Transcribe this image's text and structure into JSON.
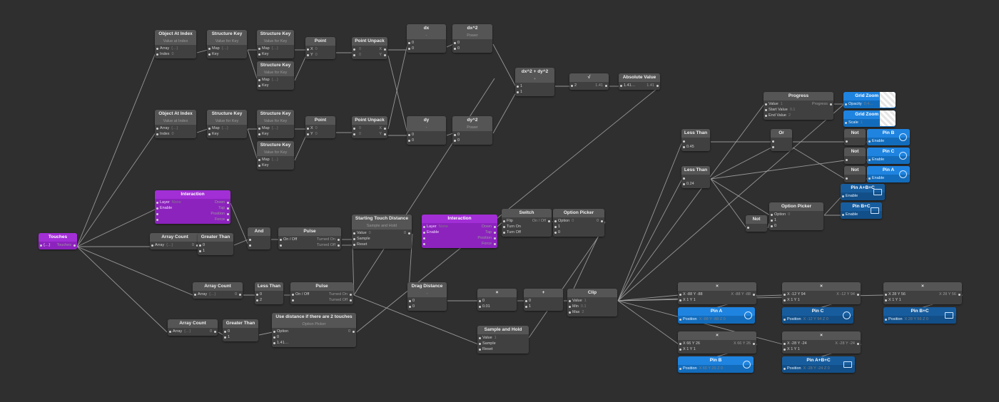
{
  "nodes": {
    "obj_at_index_1": {
      "title": "Object At Index",
      "sub": "Value at Index",
      "rows": [
        {
          "label": "Array",
          "value": "{…}"
        },
        {
          "label": "Index",
          "value": "0"
        }
      ]
    },
    "struct_key_1": {
      "title": "Structure Key",
      "sub": "Value for Key",
      "rows": [
        {
          "label": "Map",
          "value": "{…}"
        },
        {
          "label": "Key",
          "value": ""
        }
      ]
    },
    "struct_key_2": {
      "title": "Structure Key",
      "sub": "Value for Key",
      "rows": [
        {
          "label": "Map",
          "value": "{…}"
        },
        {
          "label": "Key",
          "value": ""
        }
      ]
    },
    "struct_key_3": {
      "title": "Structure Key",
      "sub": "Value for Key",
      "rows": [
        {
          "label": "Map",
          "value": "{…}"
        },
        {
          "label": "Key",
          "value": ""
        }
      ]
    },
    "point_1": {
      "title": "Point",
      "rows": [
        {
          "label": "X",
          "value": "0"
        },
        {
          "label": "Y",
          "value": "0"
        }
      ]
    },
    "point_unpack_1": {
      "title": "Point Unpack",
      "rows": [
        {
          "label": "",
          "value": "0",
          "out": "X"
        },
        {
          "label": "",
          "value": "0",
          "out": "Y"
        }
      ]
    },
    "dx": {
      "title": "dx",
      "sub": "-",
      "rows": [
        {
          "label": "0"
        },
        {
          "label": "0"
        }
      ]
    },
    "dx2": {
      "title": "dx^2",
      "sub": "Power",
      "rows": [
        {
          "label": "0"
        },
        {
          "label": "0"
        }
      ]
    },
    "obj_at_index_2": {
      "title": "Object At Index",
      "sub": "Value at Index",
      "rows": [
        {
          "label": "Array",
          "value": "{…}"
        },
        {
          "label": "Index",
          "value": "0"
        }
      ]
    },
    "struct_key_4": {
      "title": "Structure Key",
      "sub": "Value for Key",
      "rows": [
        {
          "label": "Map",
          "value": "{…}"
        },
        {
          "label": "Key",
          "value": ""
        }
      ]
    },
    "struct_key_5": {
      "title": "Structure Key",
      "sub": "Value for Key",
      "rows": [
        {
          "label": "Map",
          "value": "{…}"
        },
        {
          "label": "Key",
          "value": ""
        }
      ]
    },
    "struct_key_6": {
      "title": "Structure Key",
      "sub": "Value for Key",
      "rows": [
        {
          "label": "Map",
          "value": "{…}"
        },
        {
          "label": "Key",
          "value": ""
        }
      ]
    },
    "point_2": {
      "title": "Point",
      "rows": [
        {
          "label": "X",
          "value": "0"
        },
        {
          "label": "Y",
          "value": "0"
        }
      ]
    },
    "point_unpack_2": {
      "title": "Point Unpack",
      "rows": [
        {
          "label": "",
          "value": "0",
          "out": "X"
        },
        {
          "label": "",
          "value": "0",
          "out": "Y"
        }
      ]
    },
    "dy": {
      "title": "dy",
      "sub": "-",
      "rows": [
        {
          "label": "0"
        },
        {
          "label": "0"
        }
      ]
    },
    "dy2": {
      "title": "dy^2",
      "sub": "Power",
      "rows": [
        {
          "label": "0"
        },
        {
          "label": "0"
        }
      ]
    },
    "sum": {
      "title": "dx^2 + dy^2",
      "sub": "+",
      "rows": [
        {
          "label": "1"
        },
        {
          "label": "1"
        }
      ]
    },
    "sqrt": {
      "title": "√",
      "rows": [
        {
          "label": "2",
          "out": "1.41"
        }
      ]
    },
    "absval": {
      "title": "Absolute Value",
      "rows": [
        {
          "label": "1.41…",
          "out": "1.41"
        }
      ]
    },
    "touches": {
      "title": "Touches",
      "rows": [
        {
          "label": "{…}",
          "out": "Touches"
        }
      ]
    },
    "interaction_1": {
      "title": "Interaction",
      "rows": [
        {
          "label": "Layer",
          "value": "None",
          "out": "Down"
        },
        {
          "label": "Enable",
          "out": "Tap"
        },
        {
          "label": "",
          "out": "Position"
        },
        {
          "label": "",
          "out": "Force"
        }
      ]
    },
    "array_count_1": {
      "title": "Array Count",
      "rows": [
        {
          "label": "Array",
          "value": "{…}",
          "out": "0"
        }
      ]
    },
    "greater_than_1": {
      "title": "Greater Than",
      "rows": [
        {
          "label": "0"
        },
        {
          "label": "1"
        }
      ]
    },
    "and": {
      "title": "And",
      "rows": [
        {
          "label": ""
        },
        {
          "label": ""
        }
      ]
    },
    "pulse_1": {
      "title": "Pulse",
      "rows": [
        {
          "label": "On / Off",
          "out": "Turned On"
        },
        {
          "label": "",
          "out": "Turned Off"
        }
      ]
    },
    "start_touch": {
      "title": "Starting Touch Distance",
      "sub": "Sample and Hold",
      "rows": [
        {
          "label": "Value",
          "value": "0",
          "out": "0"
        },
        {
          "label": "Sample"
        },
        {
          "label": "Reset"
        }
      ]
    },
    "interaction_2": {
      "title": "Interaction",
      "rows": [
        {
          "label": "Layer",
          "value": "None",
          "out": "Down"
        },
        {
          "label": "Enable",
          "out": "Tap"
        },
        {
          "label": "",
          "out": "Position"
        },
        {
          "label": "",
          "out": "Force"
        }
      ]
    },
    "switch": {
      "title": "Switch",
      "rows": [
        {
          "label": "Flip",
          "out": "On / Off"
        },
        {
          "label": "Turn On"
        },
        {
          "label": "Turn Off"
        }
      ]
    },
    "option_picker_1": {
      "title": "Option Picker",
      "rows": [
        {
          "label": "Option",
          "value": "0",
          "out": "0"
        },
        {
          "label": "1"
        },
        {
          "label": "0"
        }
      ]
    },
    "array_count_2": {
      "title": "Array Count",
      "rows": [
        {
          "label": "Array",
          "value": "{…}",
          "out": "0"
        }
      ]
    },
    "less_than_1": {
      "title": "Less Than",
      "rows": [
        {
          "label": "0"
        },
        {
          "label": "2"
        }
      ]
    },
    "pulse_2": {
      "title": "Pulse",
      "rows": [
        {
          "label": "On / Off",
          "out": "Turned On"
        },
        {
          "label": "",
          "out": "Turned Off"
        }
      ]
    },
    "array_count_3": {
      "title": "Array Count",
      "rows": [
        {
          "label": "Array",
          "value": "{…}",
          "out": "0"
        }
      ]
    },
    "greater_than_2": {
      "title": "Greater Than",
      "rows": [
        {
          "label": "0"
        },
        {
          "label": "1"
        }
      ]
    },
    "use_distance": {
      "title": "Use distance if there are 2 touches",
      "sub": "Option Picker",
      "rows": [
        {
          "label": "Option",
          "out": "0"
        },
        {
          "label": "0"
        },
        {
          "label": "1.41…"
        }
      ]
    },
    "drag_distance": {
      "title": "Drag Distance",
      "sub": "-",
      "rows": [
        {
          "label": "0"
        },
        {
          "label": "0"
        }
      ]
    },
    "multiply": {
      "title": "×",
      "rows": [
        {
          "label": "0"
        },
        {
          "label": "0.01"
        }
      ]
    },
    "plus": {
      "title": "+",
      "rows": [
        {
          "label": "0"
        },
        {
          "label": "1"
        }
      ]
    },
    "clip": {
      "title": "Clip",
      "rows": [
        {
          "label": "Value",
          "value": "1"
        },
        {
          "label": "Min",
          "value": "0.1"
        },
        {
          "label": "Max",
          "value": "2"
        }
      ]
    },
    "sample_hold": {
      "title": "Sample and Hold",
      "rows": [
        {
          "label": "Value",
          "value": "1"
        },
        {
          "label": "Sample"
        },
        {
          "label": "Reset"
        }
      ]
    },
    "less_than_2": {
      "title": "Less Than",
      "rows": [
        {
          "label": ""
        },
        {
          "label": "0.45"
        }
      ]
    },
    "less_than_3": {
      "title": "Less Than",
      "rows": [
        {
          "label": ""
        },
        {
          "label": "0.24"
        }
      ]
    },
    "progress": {
      "title": "Progress",
      "rows": [
        {
          "label": "Value",
          "value": "1",
          "out": "Progress"
        },
        {
          "label": "Start Value",
          "value": "0.1"
        },
        {
          "label": "End Value",
          "value": "2"
        }
      ]
    },
    "or": {
      "title": "Or",
      "rows": [
        {
          "label": ""
        },
        {
          "label": ""
        }
      ]
    },
    "not_1": {
      "title": "Not",
      "rows": [
        {
          "label": ""
        }
      ]
    },
    "not_2": {
      "title": "Not",
      "rows": [
        {
          "label": ""
        }
      ]
    },
    "not_3": {
      "title": "Not",
      "rows": [
        {
          "label": ""
        }
      ]
    },
    "not_4": {
      "title": "Not",
      "rows": [
        {
          "label": ""
        }
      ]
    },
    "option_picker_2": {
      "title": "Option Picker",
      "rows": [
        {
          "label": "Option",
          "value": "0"
        },
        {
          "label": "1"
        },
        {
          "label": "0"
        }
      ]
    },
    "grid_zoom_1": {
      "title": "Grid Zoom In",
      "rows": [
        {
          "label": "Opacity",
          "value": "0.4…"
        }
      ]
    },
    "grid_zoom_2": {
      "title": "Grid Zoom In",
      "rows": [
        {
          "label": "Scale",
          "value": "1"
        }
      ]
    },
    "pin_b_enable": {
      "title": "Pin B",
      "rows": [
        {
          "label": "Enable"
        }
      ]
    },
    "pin_c_enable": {
      "title": "Pin C",
      "rows": [
        {
          "label": "Enable"
        }
      ]
    },
    "pin_a_enable": {
      "title": "Pin A",
      "rows": [
        {
          "label": "Enable"
        }
      ]
    },
    "pin_abc_enable": {
      "title": "Pin A+B+C",
      "rows": [
        {
          "label": "Enable"
        }
      ]
    },
    "pin_bc_enable": {
      "title": "Pin B+C",
      "rows": [
        {
          "label": "Enable"
        }
      ]
    },
    "mul_a": {
      "title": "×",
      "rows": [
        {
          "label": "X -88 Y -88",
          "out": "X -88 Y -88"
        },
        {
          "label": "X 1 Y 1"
        }
      ]
    },
    "mul_c": {
      "title": "×",
      "rows": [
        {
          "label": "X -12 Y 94",
          "out": "X -12 Y 94"
        },
        {
          "label": "X 1 Y 1"
        }
      ]
    },
    "mul_bc": {
      "title": "×",
      "rows": [
        {
          "label": "X 28 Y 56",
          "out": "X 28 Y 56"
        },
        {
          "label": "X 1 Y 1"
        }
      ]
    },
    "mul_b": {
      "title": "×",
      "rows": [
        {
          "label": "X 66 Y 26",
          "out": "X 66 Y 26"
        },
        {
          "label": "X 1 Y 1"
        }
      ]
    },
    "mul_abc": {
      "title": "×",
      "rows": [
        {
          "label": "X -28 Y -24",
          "out": "X -28 Y -24"
        },
        {
          "label": "X 1 Y 1"
        }
      ]
    },
    "pin_a_pos": {
      "title": "Pin A",
      "rows": [
        {
          "label": "Position",
          "value": "X -88 Y -88 Z 0"
        }
      ]
    },
    "pin_c_pos": {
      "title": "Pin C",
      "rows": [
        {
          "label": "Position",
          "value": "X -12 Y 94 Z 0"
        }
      ]
    },
    "pin_bc_pos": {
      "title": "Pin B+C",
      "rows": [
        {
          "label": "Position",
          "value": "X 28 Y 56 Z 0"
        }
      ]
    },
    "pin_b_pos": {
      "title": "Pin B",
      "rows": [
        {
          "label": "Position",
          "value": "X 66 Y 26 Z 0"
        }
      ]
    },
    "pin_abc_pos": {
      "title": "Pin A+B+C",
      "rows": [
        {
          "label": "Position",
          "value": "X -28 Y -24 Z 0"
        }
      ]
    }
  },
  "colors": {
    "canvas": "#2f2f2f",
    "patch": "#a22ed6",
    "layer": "#1f84e0",
    "layer_group": "#175d9e"
  }
}
